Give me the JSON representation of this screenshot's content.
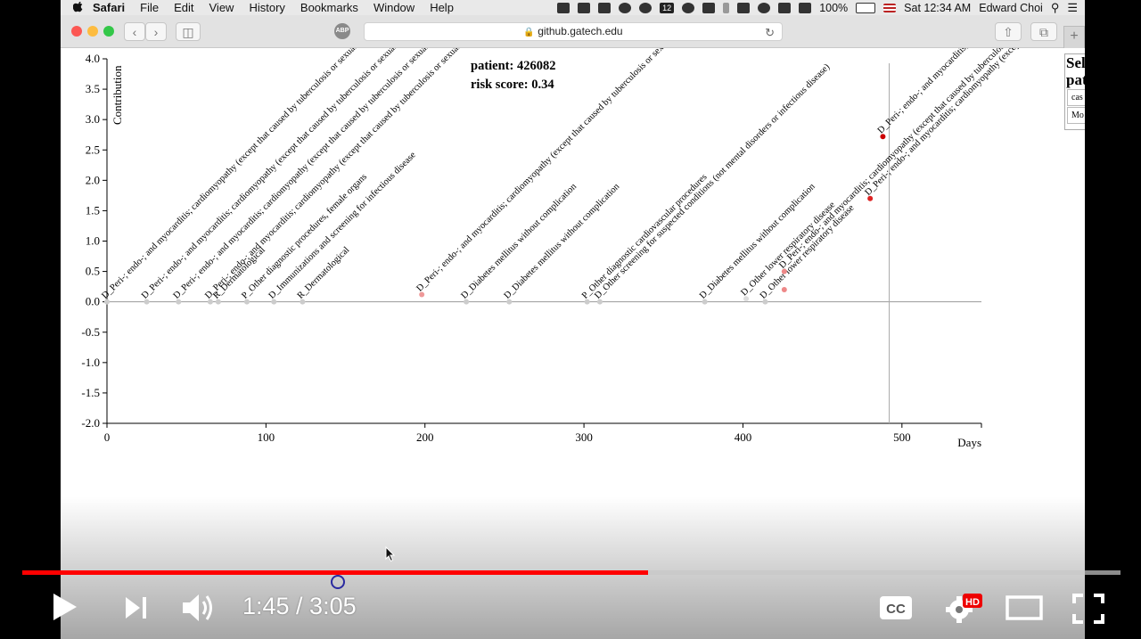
{
  "menubar": {
    "app_name": "Safari",
    "menus": [
      "File",
      "Edit",
      "View",
      "History",
      "Bookmarks",
      "Window",
      "Help"
    ],
    "status_badge": "12",
    "battery": "100%",
    "datetime": "Sat 12:34 AM",
    "user": "Edward Choi"
  },
  "browser": {
    "address": "github.gatech.edu",
    "abp_label": "ABP"
  },
  "page": {
    "patient_label": "patient: 426082",
    "risk_label": "risk score: 0.34",
    "side_title": "Selc pati",
    "side_options": [
      "cas",
      "Mo"
    ]
  },
  "chart_data": {
    "type": "scatter",
    "xlabel": "Days",
    "ylabel": "Contribution",
    "xlim": [
      0,
      550
    ],
    "ylim": [
      -2.0,
      4.0
    ],
    "xticks": [
      0,
      100,
      200,
      300,
      400,
      500
    ],
    "yticks": [
      "4.0",
      "3.5",
      "3.0",
      "2.5",
      "2.0",
      "1.5",
      "1.0",
      "0.5",
      "0.0",
      "-0.5",
      "-1.0",
      "-1.5",
      "-2.0"
    ],
    "current_day": 492,
    "points": [
      {
        "day": 0,
        "value": 0.0,
        "label": "D_Peri-; endo-; and myocarditis; cardiomyopathy (except that caused by tuberculosis or sexually",
        "color": "#cccccc"
      },
      {
        "day": 25,
        "value": 0.0,
        "label": "D_Peri-; endo-; and myocarditis; cardiomyopathy (except that caused by tuberculosis or sexually",
        "color": "#cccccc"
      },
      {
        "day": 45,
        "value": 0.0,
        "label": "D_Peri-; endo-; and myocarditis; cardiomyopathy (except that caused by tuberculosis or sexually",
        "color": "#cccccc"
      },
      {
        "day": 65,
        "value": 0.0,
        "label": "D_Peri-; endo-; and myocarditis; cardiomyopathy (except that caused by tuberculosis or sexually",
        "color": "#cccccc"
      },
      {
        "day": 70,
        "value": 0.0,
        "label": "R_Dermatological",
        "color": "#cccccc"
      },
      {
        "day": 88,
        "value": 0.0,
        "label": "P_Other diagnostic procedures, female organs",
        "color": "#cccccc"
      },
      {
        "day": 105,
        "value": 0.0,
        "label": "D_Immunizations and screening for infectious disease",
        "color": "#cccccc"
      },
      {
        "day": 123,
        "value": 0.0,
        "label": "R_Dermatological",
        "color": "#cccccc"
      },
      {
        "day": 198,
        "value": 0.12,
        "label": "D_Peri-; endo-; and myocarditis; cardiomyopathy (except that caused by tuberculosis or sexually",
        "color": "#ee9999"
      },
      {
        "day": 226,
        "value": 0.0,
        "label": "D_Diabetes mellitus without complication",
        "color": "#cccccc"
      },
      {
        "day": 253,
        "value": 0.0,
        "label": "D_Diabetes mellitus without complication",
        "color": "#cccccc"
      },
      {
        "day": 302,
        "value": 0.0,
        "label": "P_Other diagnostic cardiovascular procedures",
        "color": "#cccccc"
      },
      {
        "day": 310,
        "value": 0.0,
        "label": "D_Other screening for suspected conditions (not mental disorders or infectious disease)",
        "color": "#cccccc"
      },
      {
        "day": 376,
        "value": 0.0,
        "label": "D_Diabetes mellitus without complication",
        "color": "#cccccc"
      },
      {
        "day": 402,
        "value": 0.05,
        "label": "D_Other lower respiratory disease",
        "color": "#dddddd"
      },
      {
        "day": 414,
        "value": 0.0,
        "label": "D_Other lower respiratory disease",
        "color": "#cccccc"
      },
      {
        "day": 426,
        "value": 0.5,
        "label": "D_Peri-; endo-; and myocarditis; cardiomyopathy (except that caused by tuberculosis",
        "color": "#ee8888"
      },
      {
        "day": 426,
        "value": 0.2,
        "label": "",
        "color": "#ee8888"
      },
      {
        "day": 480,
        "value": 1.7,
        "label": "D_Peri-; endo-; and myocarditis; cardiomyopathy (excep",
        "color": "#dd2222"
      },
      {
        "day": 488,
        "value": 2.72,
        "label": "D_Peri-; endo-; and myocarditis; cardiomyopathy (except that caused by tuberculo",
        "color": "#cc0000"
      }
    ]
  },
  "player": {
    "time": "1:45 / 3:05",
    "progress": 0.57,
    "hd_badge": "HD",
    "cc_label": "CC"
  }
}
